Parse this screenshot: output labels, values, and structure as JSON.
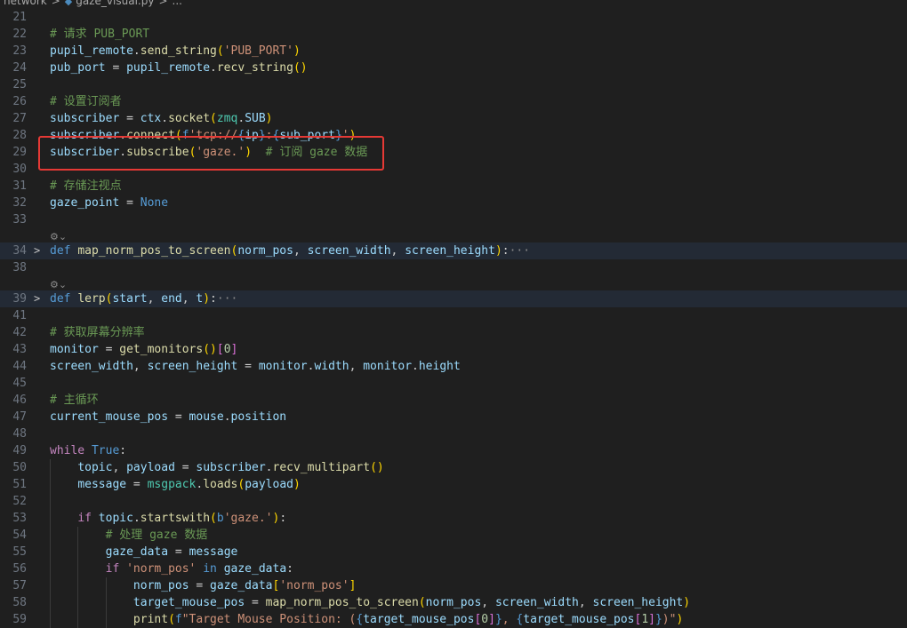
{
  "breadcrumb": {
    "folder": "network",
    "separator": ">",
    "file": "gaze_visual.py",
    "trail": "..."
  },
  "code_lens_label": "⚙",
  "lines": [
    {
      "n": "21",
      "tokens": []
    },
    {
      "n": "22",
      "tokens": [
        [
          "comment",
          "# 请求 PUB_PORT"
        ]
      ]
    },
    {
      "n": "23",
      "tokens": [
        [
          "var",
          "pupil_remote"
        ],
        [
          "plain",
          "."
        ],
        [
          "fn",
          "send_string"
        ],
        [
          "brace1",
          "("
        ],
        [
          "string",
          "'PUB_PORT'"
        ],
        [
          "brace1",
          ")"
        ]
      ]
    },
    {
      "n": "24",
      "tokens": [
        [
          "var",
          "pub_port"
        ],
        [
          "plain",
          " = "
        ],
        [
          "var",
          "pupil_remote"
        ],
        [
          "plain",
          "."
        ],
        [
          "fn",
          "recv_string"
        ],
        [
          "brace1",
          "()"
        ]
      ]
    },
    {
      "n": "25",
      "tokens": []
    },
    {
      "n": "26",
      "tokens": [
        [
          "comment",
          "# 设置订阅者"
        ]
      ]
    },
    {
      "n": "27",
      "tokens": [
        [
          "var",
          "subscriber"
        ],
        [
          "plain",
          " = "
        ],
        [
          "var",
          "ctx"
        ],
        [
          "plain",
          "."
        ],
        [
          "fn",
          "socket"
        ],
        [
          "brace1",
          "("
        ],
        [
          "class",
          "zmq"
        ],
        [
          "plain",
          "."
        ],
        [
          "var",
          "SUB"
        ],
        [
          "brace1",
          ")"
        ]
      ]
    },
    {
      "n": "28",
      "tokens": [
        [
          "var",
          "subscriber"
        ],
        [
          "plain",
          "."
        ],
        [
          "fn",
          "connect"
        ],
        [
          "brace1",
          "("
        ],
        [
          "keyword",
          "f"
        ],
        [
          "string",
          "'tcp://"
        ],
        [
          "keyword",
          "{"
        ],
        [
          "var",
          "ip"
        ],
        [
          "keyword",
          "}"
        ],
        [
          "string",
          ":"
        ],
        [
          "keyword",
          "{"
        ],
        [
          "var",
          "sub_port"
        ],
        [
          "keyword",
          "}"
        ],
        [
          "string",
          "'"
        ],
        [
          "brace1",
          ")"
        ]
      ]
    },
    {
      "n": "29",
      "tokens": [
        [
          "var",
          "subscriber"
        ],
        [
          "plain",
          "."
        ],
        [
          "fn",
          "subscribe"
        ],
        [
          "brace1",
          "("
        ],
        [
          "string",
          "'gaze.'"
        ],
        [
          "brace1",
          ")"
        ],
        [
          "plain",
          "  "
        ],
        [
          "comment",
          "# 订阅 gaze 数据"
        ]
      ]
    },
    {
      "n": "30",
      "tokens": []
    },
    {
      "n": "31",
      "tokens": [
        [
          "comment",
          "# 存储注视点"
        ]
      ]
    },
    {
      "n": "32",
      "tokens": [
        [
          "var",
          "gaze_point"
        ],
        [
          "plain",
          " = "
        ],
        [
          "keyword",
          "None"
        ]
      ]
    },
    {
      "n": "33",
      "tokens": []
    },
    {
      "n": "34",
      "fold": true,
      "highlight": true,
      "lens": true,
      "tokens": [
        [
          "keyword",
          "def "
        ],
        [
          "fn",
          "map_norm_pos_to_screen"
        ],
        [
          "brace1",
          "("
        ],
        [
          "var",
          "norm_pos"
        ],
        [
          "plain",
          ", "
        ],
        [
          "var",
          "screen_width"
        ],
        [
          "plain",
          ", "
        ],
        [
          "var",
          "screen_height"
        ],
        [
          "brace1",
          ")"
        ],
        [
          "plain",
          ":"
        ],
        [
          "ellipsis",
          "···"
        ]
      ]
    },
    {
      "n": "38",
      "tokens": []
    },
    {
      "n": "39",
      "fold": true,
      "highlight": true,
      "lens": true,
      "tokens": [
        [
          "keyword",
          "def "
        ],
        [
          "fn",
          "lerp"
        ],
        [
          "brace1",
          "("
        ],
        [
          "var",
          "start"
        ],
        [
          "plain",
          ", "
        ],
        [
          "var",
          "end"
        ],
        [
          "plain",
          ", "
        ],
        [
          "var",
          "t"
        ],
        [
          "brace1",
          ")"
        ],
        [
          "plain",
          ":"
        ],
        [
          "ellipsis",
          "···"
        ]
      ]
    },
    {
      "n": "41",
      "tokens": []
    },
    {
      "n": "42",
      "tokens": [
        [
          "comment",
          "# 获取屏幕分辨率"
        ]
      ]
    },
    {
      "n": "43",
      "tokens": [
        [
          "var",
          "monitor"
        ],
        [
          "plain",
          " = "
        ],
        [
          "fn",
          "get_monitors"
        ],
        [
          "brace1",
          "()"
        ],
        [
          "brace2",
          "["
        ],
        [
          "number",
          "0"
        ],
        [
          "brace2",
          "]"
        ]
      ]
    },
    {
      "n": "44",
      "tokens": [
        [
          "var",
          "screen_width"
        ],
        [
          "plain",
          ", "
        ],
        [
          "var",
          "screen_height"
        ],
        [
          "plain",
          " = "
        ],
        [
          "var",
          "monitor"
        ],
        [
          "plain",
          "."
        ],
        [
          "var",
          "width"
        ],
        [
          "plain",
          ", "
        ],
        [
          "var",
          "monitor"
        ],
        [
          "plain",
          "."
        ],
        [
          "var",
          "height"
        ]
      ]
    },
    {
      "n": "45",
      "tokens": []
    },
    {
      "n": "46",
      "tokens": [
        [
          "comment",
          "# 主循环"
        ]
      ]
    },
    {
      "n": "47",
      "tokens": [
        [
          "var",
          "current_mouse_pos"
        ],
        [
          "plain",
          " = "
        ],
        [
          "var",
          "mouse"
        ],
        [
          "plain",
          "."
        ],
        [
          "var",
          "position"
        ]
      ]
    },
    {
      "n": "48",
      "tokens": []
    },
    {
      "n": "49",
      "tokens": [
        [
          "control",
          "while "
        ],
        [
          "keyword",
          "True"
        ],
        [
          "plain",
          ":"
        ]
      ]
    },
    {
      "n": "50",
      "tokens": [
        [
          "plain",
          "    "
        ],
        [
          "var",
          "topic"
        ],
        [
          "plain",
          ", "
        ],
        [
          "var",
          "payload"
        ],
        [
          "plain",
          " = "
        ],
        [
          "var",
          "subscriber"
        ],
        [
          "plain",
          "."
        ],
        [
          "fn",
          "recv_multipart"
        ],
        [
          "brace1",
          "()"
        ]
      ]
    },
    {
      "n": "51",
      "tokens": [
        [
          "plain",
          "    "
        ],
        [
          "var",
          "message"
        ],
        [
          "plain",
          " = "
        ],
        [
          "class",
          "msgpack"
        ],
        [
          "plain",
          "."
        ],
        [
          "fn",
          "loads"
        ],
        [
          "brace1",
          "("
        ],
        [
          "var",
          "payload"
        ],
        [
          "brace1",
          ")"
        ]
      ]
    },
    {
      "n": "52",
      "tokens": []
    },
    {
      "n": "53",
      "tokens": [
        [
          "plain",
          "    "
        ],
        [
          "control",
          "if "
        ],
        [
          "var",
          "topic"
        ],
        [
          "plain",
          "."
        ],
        [
          "fn",
          "startswith"
        ],
        [
          "brace1",
          "("
        ],
        [
          "keyword",
          "b"
        ],
        [
          "string",
          "'gaze.'"
        ],
        [
          "brace1",
          ")"
        ],
        [
          "plain",
          ":"
        ]
      ]
    },
    {
      "n": "54",
      "tokens": [
        [
          "plain",
          "        "
        ],
        [
          "comment",
          "# 处理 gaze 数据"
        ]
      ]
    },
    {
      "n": "55",
      "tokens": [
        [
          "plain",
          "        "
        ],
        [
          "var",
          "gaze_data"
        ],
        [
          "plain",
          " = "
        ],
        [
          "var",
          "message"
        ]
      ]
    },
    {
      "n": "56",
      "tokens": [
        [
          "plain",
          "        "
        ],
        [
          "control",
          "if "
        ],
        [
          "string",
          "'norm_pos'"
        ],
        [
          "keyword",
          " in "
        ],
        [
          "var",
          "gaze_data"
        ],
        [
          "plain",
          ":"
        ]
      ]
    },
    {
      "n": "57",
      "tokens": [
        [
          "plain",
          "            "
        ],
        [
          "var",
          "norm_pos"
        ],
        [
          "plain",
          " = "
        ],
        [
          "var",
          "gaze_data"
        ],
        [
          "brace1",
          "["
        ],
        [
          "string",
          "'norm_pos'"
        ],
        [
          "brace1",
          "]"
        ]
      ]
    },
    {
      "n": "58",
      "tokens": [
        [
          "plain",
          "            "
        ],
        [
          "var",
          "target_mouse_pos"
        ],
        [
          "plain",
          " = "
        ],
        [
          "fn",
          "map_norm_pos_to_screen"
        ],
        [
          "brace1",
          "("
        ],
        [
          "var",
          "norm_pos"
        ],
        [
          "plain",
          ", "
        ],
        [
          "var",
          "screen_width"
        ],
        [
          "plain",
          ", "
        ],
        [
          "var",
          "screen_height"
        ],
        [
          "brace1",
          ")"
        ]
      ]
    },
    {
      "n": "59",
      "tokens": [
        [
          "plain",
          "            "
        ],
        [
          "fn",
          "print"
        ],
        [
          "brace1",
          "("
        ],
        [
          "keyword",
          "f"
        ],
        [
          "string",
          "\"Target Mouse Position: ("
        ],
        [
          "keyword",
          "{"
        ],
        [
          "var",
          "target_mouse_pos"
        ],
        [
          "brace2",
          "["
        ],
        [
          "number",
          "0"
        ],
        [
          "brace2",
          "]"
        ],
        [
          "keyword",
          "}"
        ],
        [
          "string",
          ", "
        ],
        [
          "keyword",
          "{"
        ],
        [
          "var",
          "target_mouse_pos"
        ],
        [
          "brace2",
          "["
        ],
        [
          "number",
          "1"
        ],
        [
          "brace2",
          "]"
        ],
        [
          "keyword",
          "}"
        ],
        [
          "string",
          ")\""
        ],
        [
          "brace1",
          ")"
        ]
      ]
    }
  ]
}
